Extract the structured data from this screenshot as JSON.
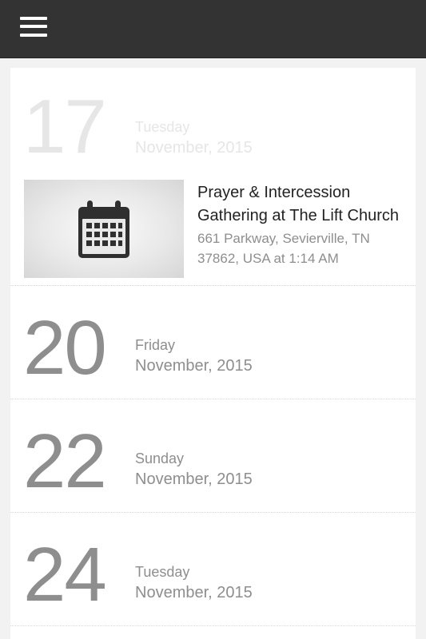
{
  "header": {
    "menu_icon": "hamburger-menu-icon",
    "background_color": "#333333"
  },
  "calendar": {
    "days": [
      {
        "day": "17",
        "weekday": "Tuesday",
        "month_year": "November, 2015",
        "event": {
          "title": "Prayer & Intercession Gathering at The Lift Church",
          "location": "661 Parkway, Sevierville, TN 37862, USA at 1:14 AM",
          "thumbnail_icon": "calendar-icon"
        }
      },
      {
        "day": "20",
        "weekday": "Friday",
        "month_year": "November, 2015"
      },
      {
        "day": "22",
        "weekday": "Sunday",
        "month_year": "November, 2015"
      },
      {
        "day": "24",
        "weekday": "Tuesday",
        "month_year": "November, 2015"
      }
    ]
  }
}
